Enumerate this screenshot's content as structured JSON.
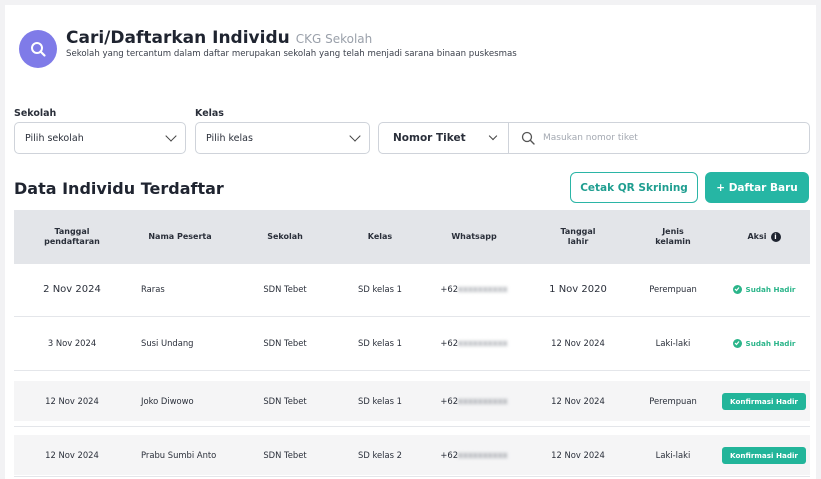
{
  "header": {
    "title": "Cari/Daftarkan Individu",
    "title_suffix": "CKG Sekolah",
    "subtitle": "Sekolah yang tercantum dalam daftar merupakan sekolah yang telah menjadi sarana binaan puskesmas",
    "icon": "search-icon",
    "accent_color": "#7f7be8"
  },
  "filters": {
    "school_label": "Sekolah",
    "school_value": "Pilih sekolah",
    "class_label": "Kelas",
    "class_value": "Pilih kelas",
    "ticket_type": "Nomor Tiket",
    "ticket_placeholder": "Masukan nomor tiket"
  },
  "section": {
    "title": "Data Individu Terdaftar",
    "print_qr_label": "Cetak QR Skrining",
    "register_label": "+ Daftar Baru",
    "brand_color": "#26b6a4"
  },
  "table": {
    "columns": [
      "Tanggal pendaftaran",
      "Nama Peserta",
      "Sekolah",
      "Kelas",
      "Whatsapp",
      "Tanggal lahir",
      "Jenis kelamin",
      "Aksi"
    ],
    "rows": [
      {
        "registered": "2 Nov 2024",
        "name": "Raras",
        "school": "SDN Tebet",
        "class": "SD kelas 1",
        "whatsapp": "+62",
        "birth": "1 Nov 2020",
        "gender": "Perempuan",
        "action": "Sudah Hadir",
        "action_type": "status"
      },
      {
        "registered": "3 Nov 2024",
        "name": "Susi Undang",
        "school": "SDN Tebet",
        "class": "SD kelas 1",
        "whatsapp": "+62",
        "birth": "12 Nov 2024",
        "gender": "Laki-laki",
        "action": "Sudah Hadir",
        "action_type": "status"
      },
      {
        "registered": "12 Nov 2024",
        "name": "Joko Diwowo",
        "school": "SDN Tebet",
        "class": "SD kelas 1",
        "whatsapp": "+62",
        "birth": "12 Nov 2024",
        "gender": "Perempuan",
        "action": "Konfirmasi Hadir",
        "action_type": "button"
      },
      {
        "registered": "12 Nov 2024",
        "name": "Prabu Sumbi Anto",
        "school": "SDN Tebet",
        "class": "SD kelas 2",
        "whatsapp": "+62",
        "birth": "12 Nov 2024",
        "gender": "Laki-laki",
        "action": "Konfirmasi Hadir",
        "action_type": "button"
      }
    ]
  }
}
